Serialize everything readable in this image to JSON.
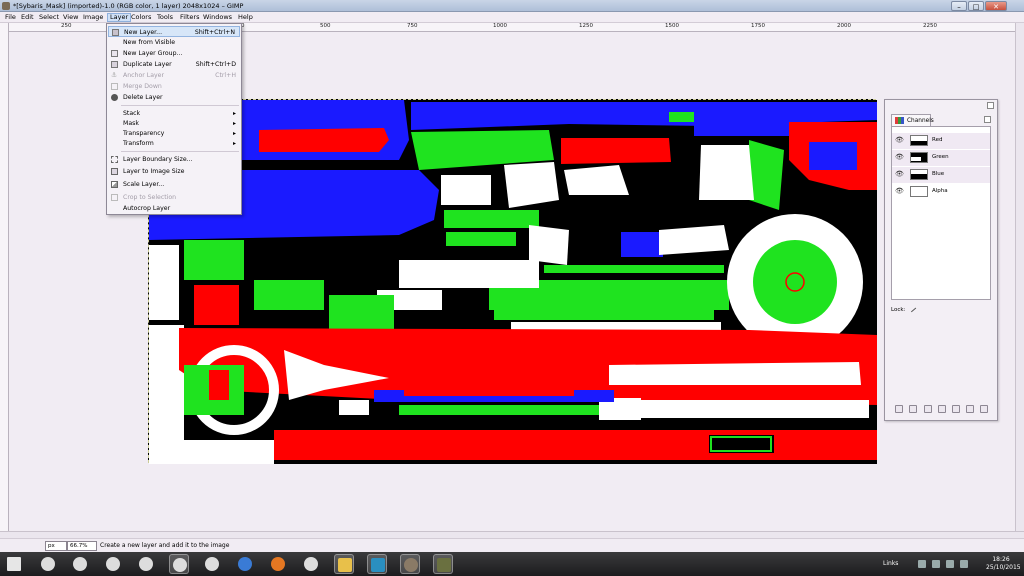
{
  "window": {
    "title": "*[Sybaris_Mask] (imported)-1.0 (RGB color, 1 layer) 2048x1024 – GIMP",
    "minimize": "–",
    "maximize": "□",
    "close": "✕"
  },
  "menubar": {
    "items": [
      "File",
      "Edit",
      "Select",
      "View",
      "Image",
      "Layer",
      "Colors",
      "Tools",
      "Filters",
      "Windows",
      "Help"
    ]
  },
  "ruler": {
    "labels": [
      "250",
      "0",
      "250",
      "500",
      "750",
      "1000",
      "1250",
      "1500",
      "1750",
      "2000",
      "2250"
    ]
  },
  "layer_menu": {
    "items": [
      {
        "label": "New Layer...",
        "shortcut": "Shift+Ctrl+N",
        "icon": "new-layer-icon",
        "state": "highlighted"
      },
      {
        "label": "New from Visible",
        "shortcut": "",
        "icon": "",
        "state": "enabled"
      },
      {
        "label": "New Layer Group...",
        "shortcut": "",
        "icon": "layer-group-icon",
        "state": "enabled"
      },
      {
        "label": "Duplicate Layer",
        "shortcut": "Shift+Ctrl+D",
        "icon": "duplicate-icon",
        "state": "enabled"
      },
      {
        "label": "Anchor Layer",
        "shortcut": "Ctrl+H",
        "icon": "anchor-icon",
        "state": "disabled"
      },
      {
        "label": "Merge Down",
        "shortcut": "",
        "icon": "merge-icon",
        "state": "disabled"
      },
      {
        "label": "Delete Layer",
        "shortcut": "",
        "icon": "delete-icon",
        "state": "enabled"
      },
      {
        "label": "Stack",
        "shortcut": "",
        "icon": "",
        "state": "submenu"
      },
      {
        "label": "Mask",
        "shortcut": "",
        "icon": "",
        "state": "submenu"
      },
      {
        "label": "Transparency",
        "shortcut": "",
        "icon": "",
        "state": "submenu"
      },
      {
        "label": "Transform",
        "shortcut": "",
        "icon": "",
        "state": "submenu"
      },
      {
        "label": "Layer Boundary Size...",
        "shortcut": "",
        "icon": "boundary-icon",
        "state": "enabled"
      },
      {
        "label": "Layer to Image Size",
        "shortcut": "",
        "icon": "image-size-icon",
        "state": "enabled"
      },
      {
        "label": "Scale Layer...",
        "shortcut": "",
        "icon": "scale-icon",
        "state": "enabled"
      },
      {
        "label": "Crop to Selection",
        "shortcut": "",
        "icon": "crop-icon",
        "state": "disabled"
      },
      {
        "label": "Autocrop Layer",
        "shortcut": "",
        "icon": "",
        "state": "enabled"
      }
    ],
    "submenu_arrow": "▸"
  },
  "channels_dock": {
    "tab_label": "Channels",
    "channels": [
      "Red",
      "Green",
      "Blue",
      "Alpha"
    ],
    "lock_label": "Lock:",
    "eye_glyph": "👁"
  },
  "statusbar": {
    "unit": "px",
    "zoom": "66.7%",
    "message": "Create a new layer and add it to the image"
  },
  "taskbar": {
    "links_label": "Links",
    "time": "18:26",
    "date": "25/10/2015"
  },
  "colors": {
    "red": "#ff0000",
    "green": "#1fe31f",
    "blue": "#1a1aff",
    "white": "#ffffff",
    "black": "#000000"
  }
}
